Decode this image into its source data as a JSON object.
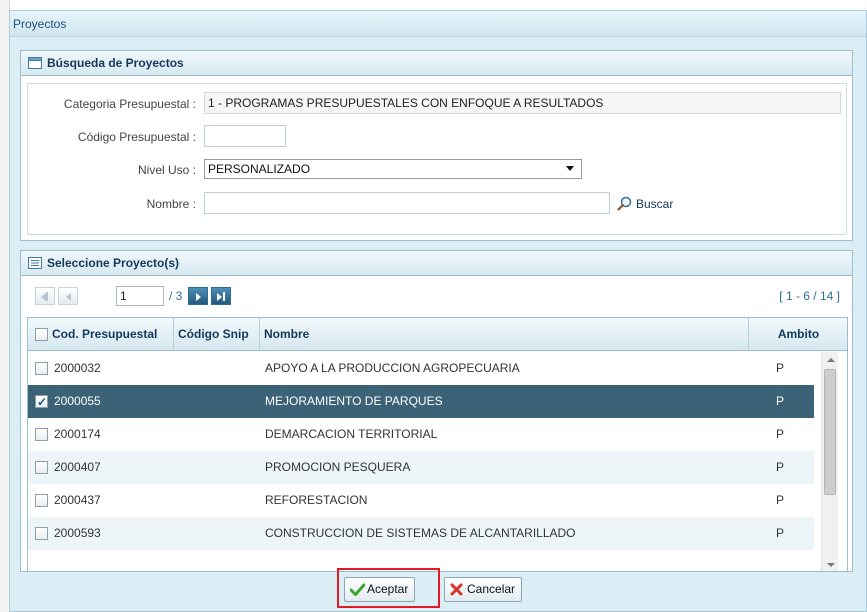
{
  "window": {
    "title": "Proyectos"
  },
  "search_panel": {
    "title": "Búsqueda de Proyectos",
    "categoria": {
      "label": "Categoria Presupuestal :",
      "value": "1 - PROGRAMAS PRESUPUESTALES CON ENFOQUE A RESULTADOS"
    },
    "codigo": {
      "label": "Código Presupuestal :",
      "value": ""
    },
    "nivel_uso": {
      "label": "Nivel Uso :",
      "value": "PERSONALIZADO"
    },
    "nombre": {
      "label": "Nombre :",
      "value": ""
    },
    "search_label": "Buscar"
  },
  "list_panel": {
    "title": "Seleccione Proyecto(s)",
    "pager": {
      "page": "1",
      "total": "/ 3",
      "range": "[ 1 - 6 / 14 ]"
    },
    "columns": [
      "Cod. Presupuestal",
      "Código Snip",
      "Nombre",
      "Ambito"
    ],
    "rows": [
      {
        "cod": "2000032",
        "snip": "",
        "nombre": "APOYO A LA PRODUCCION AGROPECUARIA",
        "ambito": "P",
        "checked": false
      },
      {
        "cod": "2000055",
        "snip": "",
        "nombre": "MEJORAMIENTO DE PARQUES",
        "ambito": "P",
        "checked": true
      },
      {
        "cod": "2000174",
        "snip": "",
        "nombre": "DEMARCACION TERRITORIAL",
        "ambito": "P",
        "checked": false
      },
      {
        "cod": "2000407",
        "snip": "",
        "nombre": "PROMOCION PESQUERA",
        "ambito": "P",
        "checked": false
      },
      {
        "cod": "2000437",
        "snip": "",
        "nombre": "REFORESTACION",
        "ambito": "P",
        "checked": false
      },
      {
        "cod": "2000593",
        "snip": "",
        "nombre": "CONSTRUCCION DE SISTEMAS DE ALCANTARILLADO",
        "ambito": "P",
        "checked": false
      }
    ]
  },
  "footer": {
    "accept_label": "Aceptar",
    "cancel_label": "Cancelar"
  },
  "colors": {
    "header_text": "#15385a",
    "selected_row": "#3c6278",
    "highlight_border": "#e11b22"
  }
}
